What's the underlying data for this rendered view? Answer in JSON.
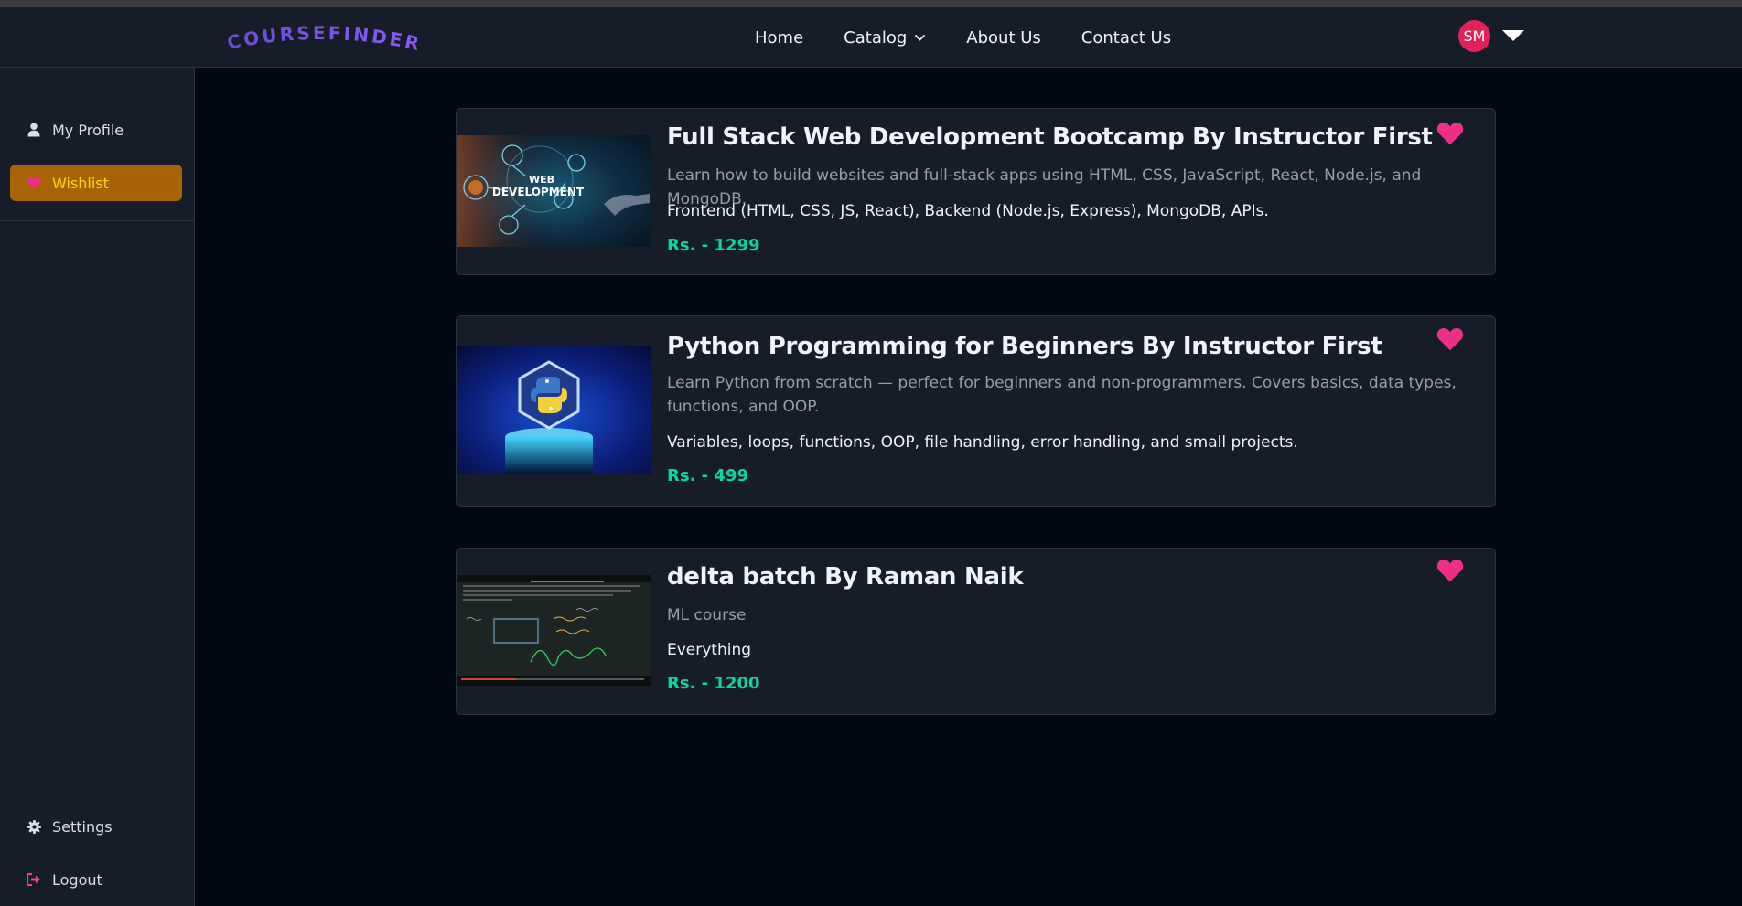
{
  "navbar": {
    "logo_text": "COURSEFINDER",
    "links": [
      {
        "label": "Home"
      },
      {
        "label": "Catalog"
      },
      {
        "label": "About Us"
      },
      {
        "label": "Contact Us"
      }
    ],
    "avatar_initials": "SM"
  },
  "sidebar": {
    "items": [
      {
        "label": "My Profile",
        "icon": "user-icon"
      },
      {
        "label": "Wishlist",
        "icon": "heart-icon",
        "active": true
      }
    ],
    "bottom_items": [
      {
        "label": "Settings",
        "icon": "gear-icon"
      },
      {
        "label": "Logout",
        "icon": "logout-icon"
      }
    ]
  },
  "wishlist": {
    "courses": [
      {
        "title": "Full Stack Web Development Bootcamp By Instructor First",
        "description": "Learn how to build websites and full-stack apps using HTML, CSS, JavaScript, React, Node.js, and MongoDB.",
        "topics": "Frontend (HTML, CSS, JS, React), Backend (Node.js, Express), MongoDB, APIs.",
        "price": "Rs. - 1299",
        "thumbnail_text": "WEB DEVELOPMENT"
      },
      {
        "title": "Python Programming for Beginners By Instructor First",
        "description": "Learn Python from scratch — perfect for beginners and non-programmers. Covers basics, data types, functions, and OOP.",
        "topics": "Variables, loops, functions, OOP, file handling, error handling, and small projects.",
        "price": "Rs. - 499"
      },
      {
        "title": "delta batch By Raman Naik",
        "description": "ML course",
        "topics": "Everything",
        "price": "Rs. - 1200"
      }
    ]
  },
  "colors": {
    "accent_yellow": "#ffd60a",
    "active_bg": "#a86305",
    "price_green": "#06d6a0",
    "heart_pink": "#ef2f87",
    "avatar_bg": "#e0215a"
  }
}
